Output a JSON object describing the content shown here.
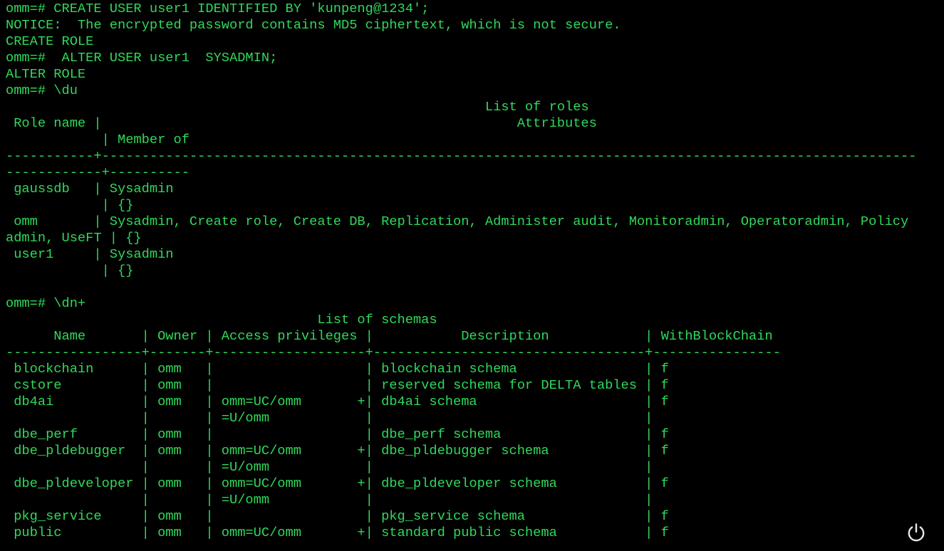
{
  "terminal": {
    "text_color": "#2fd95a",
    "background_color": "#000000",
    "lines": [
      "omm=# CREATE USER user1 IDENTIFIED BY 'kunpeng@1234';",
      "NOTICE:  The encrypted password contains MD5 ciphertext, which is not secure.",
      "CREATE ROLE",
      "omm=#  ALTER USER user1  SYSADMIN;",
      "ALTER ROLE",
      "omm=# \\du",
      "                                                            List of roles",
      " Role name |                                                    Attributes",
      "            | Member of",
      "-----------+------------------------------------------------------------------------------------------------------",
      "------------+----------",
      " gaussdb   | Sysadmin",
      "            | {}",
      " omm       | Sysadmin, Create role, Create DB, Replication, Administer audit, Monitoradmin, Operatoradmin, Policy",
      "admin, UseFT | {}",
      " user1     | Sysadmin",
      "            | {}",
      "",
      "omm=# \\dn+",
      "                                       List of schemas",
      "      Name       | Owner | Access privileges |           Description            | WithBlockChain",
      "-----------------+-------+-------------------+----------------------------------+----------------",
      " blockchain      | omm   |                   | blockchain schema                | f",
      " cstore          | omm   |                   | reserved schema for DELTA tables | f",
      " db4ai           | omm   | omm=UC/omm       +| db4ai schema                     | f",
      "                 |       | =U/omm            |                                  |",
      " dbe_perf        | omm   |                   | dbe_perf schema                  | f",
      " dbe_pldebugger  | omm   | omm=UC/omm       +| dbe_pldebugger schema            | f",
      "                 |       | =U/omm            |                                  |",
      " dbe_pldeveloper | omm   | omm=UC/omm       +| dbe_pldeveloper schema           | f",
      "                 |       | =U/omm            |                                  |",
      " pkg_service     | omm   |                   | pkg_service schema               | f",
      " public          | omm   | omm=UC/omm       +| standard public schema           | f"
    ]
  },
  "power_button": {
    "icon": "power-icon",
    "color": "#e8e8e8"
  }
}
